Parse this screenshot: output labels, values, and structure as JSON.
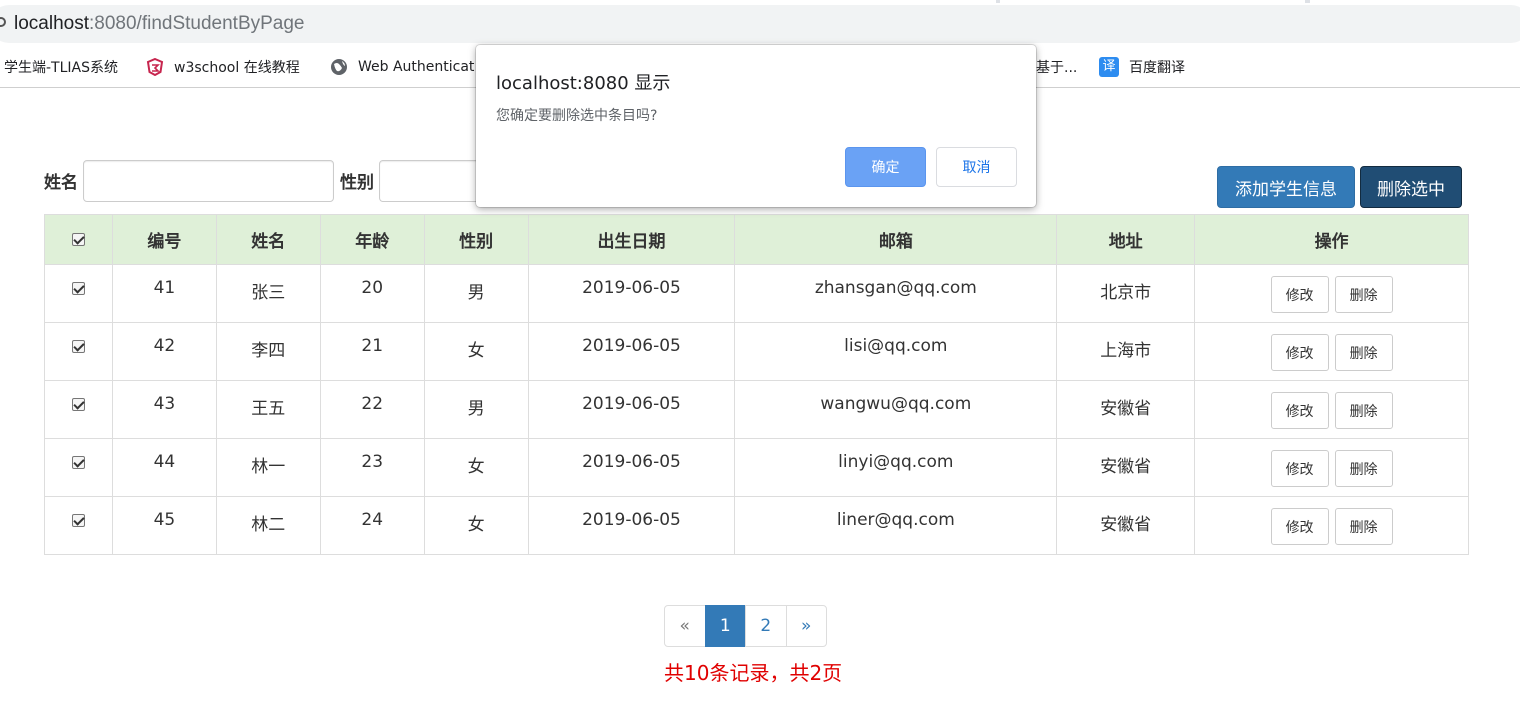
{
  "browser": {
    "url_host": "localhost",
    "url_rest": ":8080/findStudentByPage",
    "bookmarks": [
      {
        "label": "学生端-TLIAS系统",
        "icon": "none"
      },
      {
        "label": "w3school 在线教程",
        "icon": "w3school-icon",
        "color": "#c7254e"
      },
      {
        "label": "Web Authenticat",
        "icon": "globe-icon"
      },
      {
        "label": "基于...",
        "icon": "none"
      },
      {
        "label": "百度翻译",
        "icon": "translate-icon",
        "color": "#2d8cf0",
        "glyph": "译"
      }
    ]
  },
  "search": {
    "name_label": "姓名",
    "gender_label": "性别"
  },
  "toolbar": {
    "add_label": "添加学生信息",
    "delete_selected_label": "删除选中"
  },
  "table": {
    "headers": [
      "编号",
      "姓名",
      "年龄",
      "性别",
      "出生日期",
      "邮箱",
      "地址",
      "操作"
    ],
    "rows": [
      {
        "id": "41",
        "name": "张三",
        "age": "20",
        "gender": "男",
        "birthday": "2019-06-05",
        "email": "zhansgan@qq.com",
        "address": "北京市"
      },
      {
        "id": "42",
        "name": "李四",
        "age": "21",
        "gender": "女",
        "birthday": "2019-06-05",
        "email": "lisi@qq.com",
        "address": "上海市"
      },
      {
        "id": "43",
        "name": "王五",
        "age": "22",
        "gender": "男",
        "birthday": "2019-06-05",
        "email": "wangwu@qq.com",
        "address": "安徽省"
      },
      {
        "id": "44",
        "name": "林一",
        "age": "23",
        "gender": "女",
        "birthday": "2019-06-05",
        "email": "linyi@qq.com",
        "address": "安徽省"
      },
      {
        "id": "45",
        "name": "林二",
        "age": "24",
        "gender": "女",
        "birthday": "2019-06-05",
        "email": "liner@qq.com",
        "address": "安徽省"
      }
    ],
    "edit_label": "修改",
    "delete_label": "删除"
  },
  "pagination": {
    "prev": "«",
    "pages": [
      "1",
      "2"
    ],
    "active_page": "1",
    "next": "»",
    "summary": "共10条记录，共2页"
  },
  "dialog": {
    "title": "localhost:8080 显示",
    "message": "您确定要删除选中条目吗?",
    "ok_label": "确定",
    "cancel_label": "取消"
  },
  "colors": {
    "header_bg": "#dff0d8",
    "primary": "#337ab7",
    "dark_primary": "#204d74",
    "summary_text": "#e00000",
    "dialog_ok": "#6aa2f5"
  }
}
